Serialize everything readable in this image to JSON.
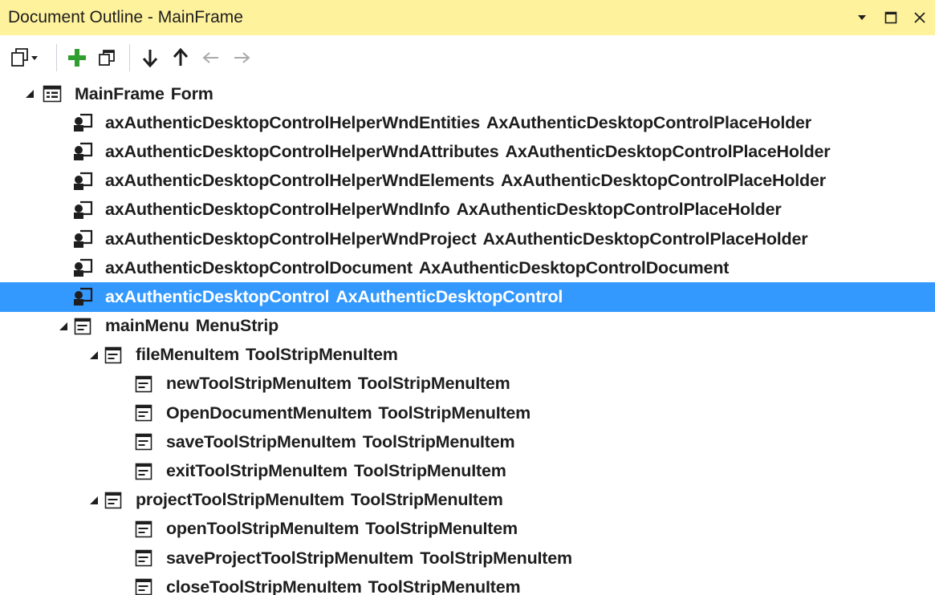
{
  "window": {
    "title": "Document Outline - MainFrame"
  },
  "toolbar": {
    "buttons": [
      "select-dropdown-icon",
      "add-icon",
      "copy-icon",
      "move-down-icon",
      "move-up-icon",
      "move-left-icon",
      "move-right-icon"
    ]
  },
  "tree": {
    "root": {
      "name": "MainFrame",
      "type": "Form"
    },
    "controls": [
      {
        "name": "axAuthenticDesktopControlHelperWndEntities",
        "type": "AxAuthenticDesktopControlPlaceHolder"
      },
      {
        "name": "axAuthenticDesktopControlHelperWndAttributes",
        "type": "AxAuthenticDesktopControlPlaceHolder"
      },
      {
        "name": "axAuthenticDesktopControlHelperWndElements",
        "type": "AxAuthenticDesktopControlPlaceHolder"
      },
      {
        "name": "axAuthenticDesktopControlHelperWndInfo",
        "type": "AxAuthenticDesktopControlPlaceHolder"
      },
      {
        "name": "axAuthenticDesktopControlHelperWndProject",
        "type": "AxAuthenticDesktopControlPlaceHolder"
      },
      {
        "name": "axAuthenticDesktopControlDocument",
        "type": "AxAuthenticDesktopControlDocument"
      },
      {
        "name": "axAuthenticDesktopControl",
        "type": "AxAuthenticDesktopControl"
      }
    ],
    "menu": {
      "name": "mainMenu",
      "type": "MenuStrip"
    },
    "fileMenu": {
      "name": "fileMenuItem",
      "type": "ToolStripMenuItem"
    },
    "fileItems": [
      {
        "name": "newToolStripMenuItem",
        "type": "ToolStripMenuItem"
      },
      {
        "name": "OpenDocumentMenuItem",
        "type": "ToolStripMenuItem"
      },
      {
        "name": "saveToolStripMenuItem",
        "type": "ToolStripMenuItem"
      },
      {
        "name": "exitToolStripMenuItem",
        "type": "ToolStripMenuItem"
      }
    ],
    "projectMenu": {
      "name": "projectToolStripMenuItem",
      "type": "ToolStripMenuItem"
    },
    "projectItems": [
      {
        "name": "openToolStripMenuItem",
        "type": "ToolStripMenuItem"
      },
      {
        "name": "saveProjectToolStripMenuItem",
        "type": "ToolStripMenuItem"
      },
      {
        "name": "closeToolStripMenuItem",
        "type": "ToolStripMenuItem"
      }
    ]
  },
  "colors": {
    "titlebar": "#fff29d",
    "selection": "#3399ff",
    "add": "#2f9e2f"
  }
}
